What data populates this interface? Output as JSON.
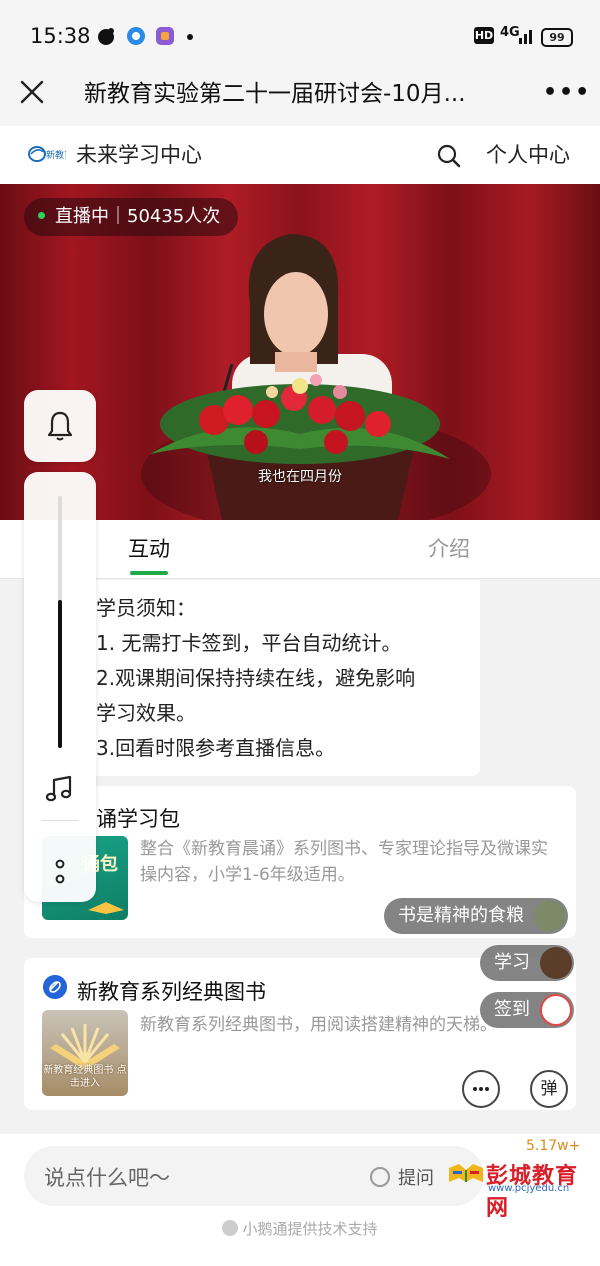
{
  "status": {
    "time": "15:38",
    "hd": "HD",
    "network": "4G",
    "battery": "99"
  },
  "titlebar": {
    "title": "新教育实验第二十一届研讨会-10月..."
  },
  "site": {
    "logo_text": "新教育",
    "name": "未来学习中心",
    "personal": "个人中心"
  },
  "video": {
    "live_status": "直播中｜50435人次",
    "subtitle": "我也在四月份"
  },
  "tabs": [
    {
      "label": "互动",
      "active": true
    },
    {
      "label": "介绍",
      "active": false
    }
  ],
  "notice": {
    "title": "学员须知：",
    "lines": [
      "1. 无需打卡签到，平台自动统计。",
      "2.观课期间保持持续在线，避免影响",
      "学习效果。",
      "3.回看时限参考直播信息。"
    ]
  },
  "courses": [
    {
      "title": "诵学习包",
      "desc": "整合《新教育晨诵》系列图书、专家理论指导及微课实操内容，小学1-6年级适用。",
      "thumb_text": "诵包"
    },
    {
      "title": "新教育系列经典图书",
      "desc": "新教育系列经典图书，用阅读搭建精神的天梯。",
      "thumb_text": "新教育经典图书 点击进入"
    }
  ],
  "danmaku": [
    {
      "text": "书是精神的食粮",
      "avatar_color": "#7c8a6a"
    },
    {
      "text": "学习",
      "avatar_color": "#5a3e2a"
    },
    {
      "text": "签到",
      "avatar_color": "#e04848"
    }
  ],
  "buttons": {
    "danmaku": "弹"
  },
  "bottom": {
    "count": "5.17w+",
    "input_placeholder": "说点什么吧～",
    "ask": "提问",
    "support": "小鹅通提供技术支持"
  },
  "watermark": {
    "title": "彭城教育网",
    "url": "www.pcjyedu.cn"
  },
  "colors": {
    "accent": "#1fab4a",
    "watermark_red": "#d8202a",
    "count_orange": "#d98b1a"
  }
}
